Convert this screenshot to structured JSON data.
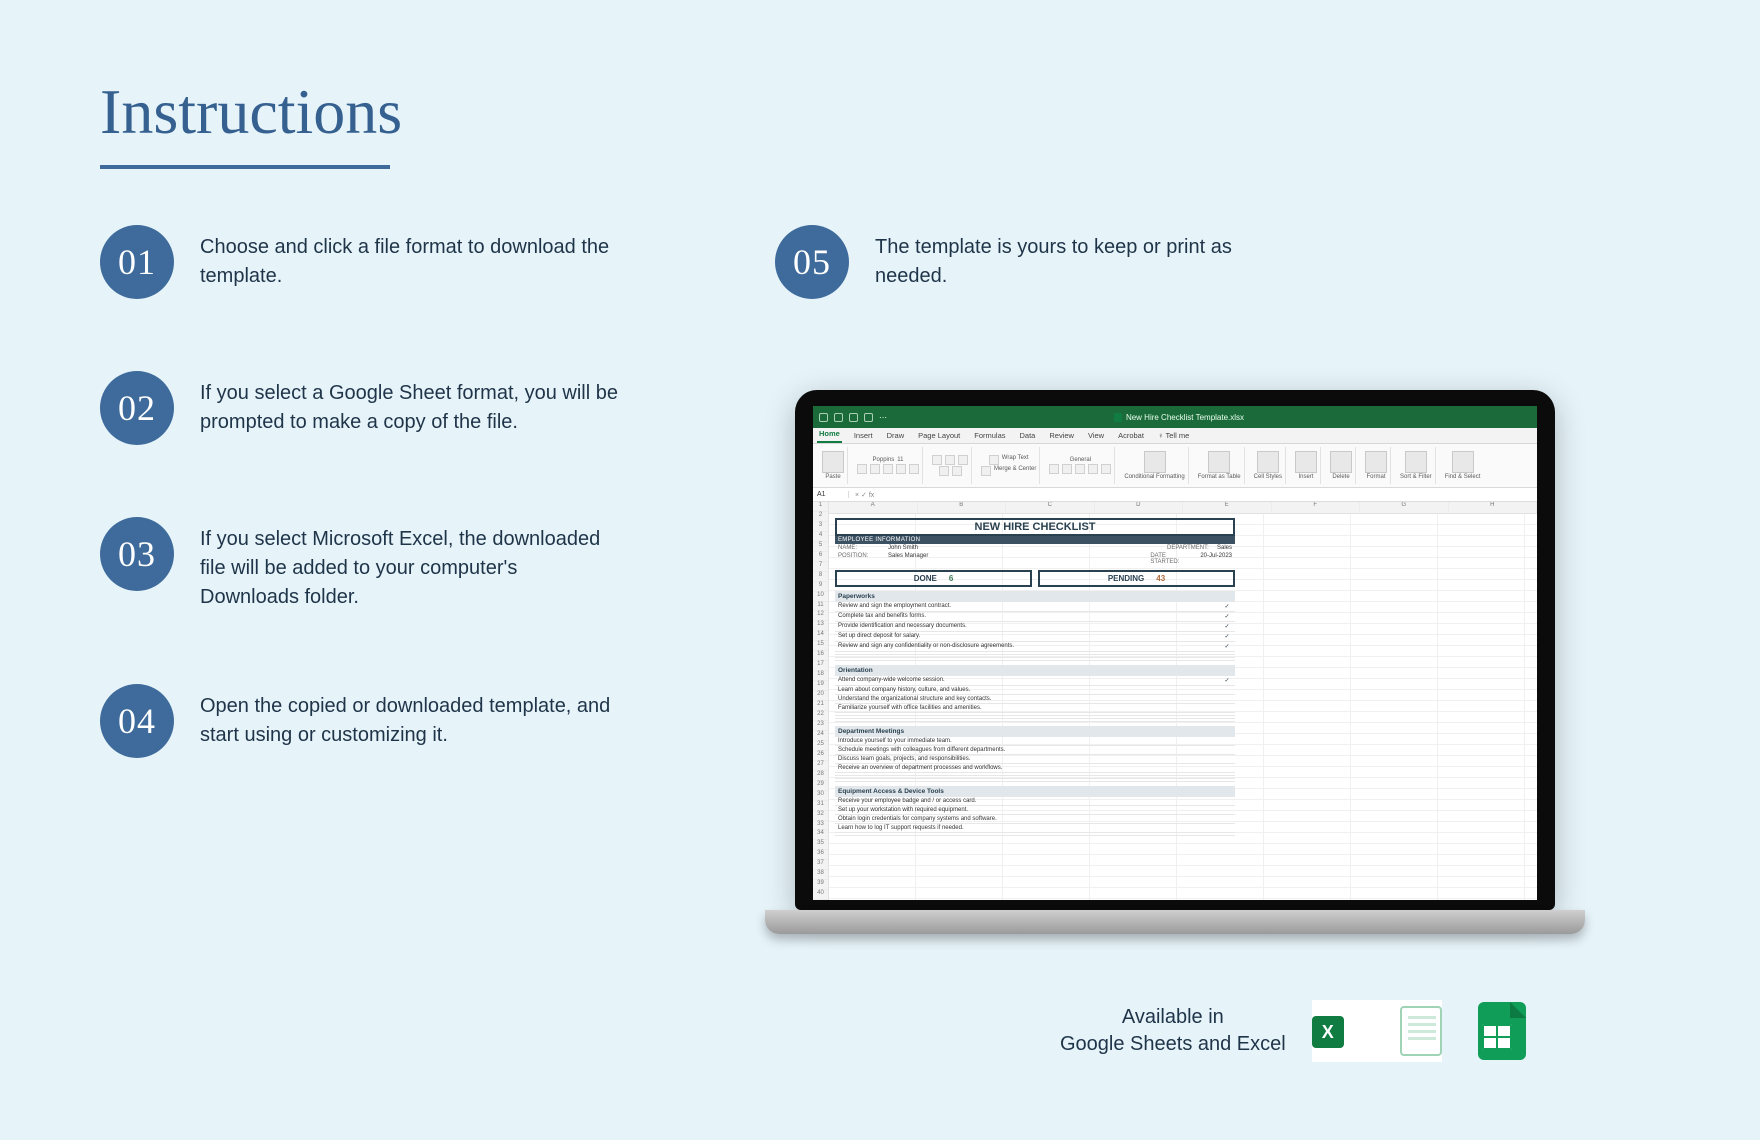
{
  "title": "Instructions",
  "steps": [
    {
      "num": "01",
      "text": "Choose and click a file format to download the template."
    },
    {
      "num": "02",
      "text": "If you select a Google Sheet format, you will be prompted to make a copy of the file."
    },
    {
      "num": "03",
      "text": "If you select Microsoft Excel, the downloaded file will be added to your computer's Downloads folder."
    },
    {
      "num": "04",
      "text": "Open the copied or downloaded template, and start using or customizing it."
    },
    {
      "num": "05",
      "text": "The template is yours to keep or print as needed."
    }
  ],
  "excel": {
    "file_name": "New Hire Checklist Template.xlsx",
    "tabs": [
      "Home",
      "Insert",
      "Draw",
      "Page Layout",
      "Formulas",
      "Data",
      "Review",
      "View",
      "Acrobat",
      "Tell me"
    ],
    "tell_me_prefix": "♀",
    "active_tab": "Home",
    "ribbon_groups": [
      "Paste",
      "Font",
      "Alignment",
      "Number",
      "Conditional Formatting",
      "Format as Table",
      "Cell Styles",
      "Insert",
      "Delete",
      "Format",
      "Sort & Filter",
      "Find & Select"
    ],
    "font_name": "Poppins",
    "font_size": "11",
    "wrap_label": "Wrap Text",
    "merge_label": "Merge & Center",
    "number_format": "General",
    "cell_ref": "A1",
    "columns": [
      "A",
      "B",
      "C",
      "D",
      "E",
      "F",
      "G",
      "H"
    ],
    "doc": {
      "title": "NEW HIRE CHECKLIST",
      "subhead": "EMPLOYEE INFORMATION",
      "info": {
        "name_label": "NAME:",
        "name_value": "John Smith",
        "dept_label": "DEPARTMENT:",
        "dept_value": "Sales",
        "pos_label": "POSITION:",
        "pos_value": "Sales Manager",
        "date_label": "DATE STARTED:",
        "date_value": "20-Jul-2023"
      },
      "metrics": {
        "done_label": "DONE",
        "done_value": "6",
        "pending_label": "PENDING",
        "pending_value": "43"
      },
      "sections": [
        {
          "title": "Paperworks",
          "items": [
            {
              "t": "Review and sign the employment contract.",
              "c": "✓"
            },
            {
              "t": "Complete tax and benefits forms.",
              "c": "✓"
            },
            {
              "t": "Provide identification and necessary documents.",
              "c": "✓"
            },
            {
              "t": "Set up direct deposit for salary.",
              "c": "✓"
            },
            {
              "t": "Review and sign any confidentiality or non-disclosure agreements.",
              "c": "✓"
            },
            {
              "t": "",
              "c": ""
            },
            {
              "t": "",
              "c": ""
            },
            {
              "t": "",
              "c": ""
            }
          ]
        },
        {
          "title": "Orientation",
          "items": [
            {
              "t": "Attend company-wide welcome session.",
              "c": "✓"
            },
            {
              "t": "Learn about company history, culture, and values.",
              "c": ""
            },
            {
              "t": "Understand the organizational structure and key contacts.",
              "c": ""
            },
            {
              "t": "Familiarize yourself with office facilities and amenities.",
              "c": ""
            },
            {
              "t": "",
              "c": ""
            },
            {
              "t": "",
              "c": ""
            },
            {
              "t": "",
              "c": ""
            }
          ]
        },
        {
          "title": "Department Meetings",
          "items": [
            {
              "t": "Introduce yourself to your immediate team.",
              "c": ""
            },
            {
              "t": "Schedule meetings with colleagues from different departments.",
              "c": ""
            },
            {
              "t": "Discuss team goals, projects, and responsibilities.",
              "c": ""
            },
            {
              "t": "Receive an overview of department processes and workflows.",
              "c": ""
            },
            {
              "t": "",
              "c": ""
            },
            {
              "t": "",
              "c": ""
            },
            {
              "t": "",
              "c": ""
            }
          ]
        },
        {
          "title": "Equipment Access & Device Tools",
          "items": [
            {
              "t": "Receive your employee badge and / or access card.",
              "c": ""
            },
            {
              "t": "Set up your workstation with required equipment.",
              "c": ""
            },
            {
              "t": "Obtain login credentials for company systems and software.",
              "c": ""
            },
            {
              "t": "Learn how to log IT support requests if needed.",
              "c": ""
            },
            {
              "t": "",
              "c": ""
            }
          ]
        }
      ]
    }
  },
  "available": {
    "line1": "Available in",
    "line2": "Google Sheets and Excel",
    "excel_letter": "X"
  }
}
